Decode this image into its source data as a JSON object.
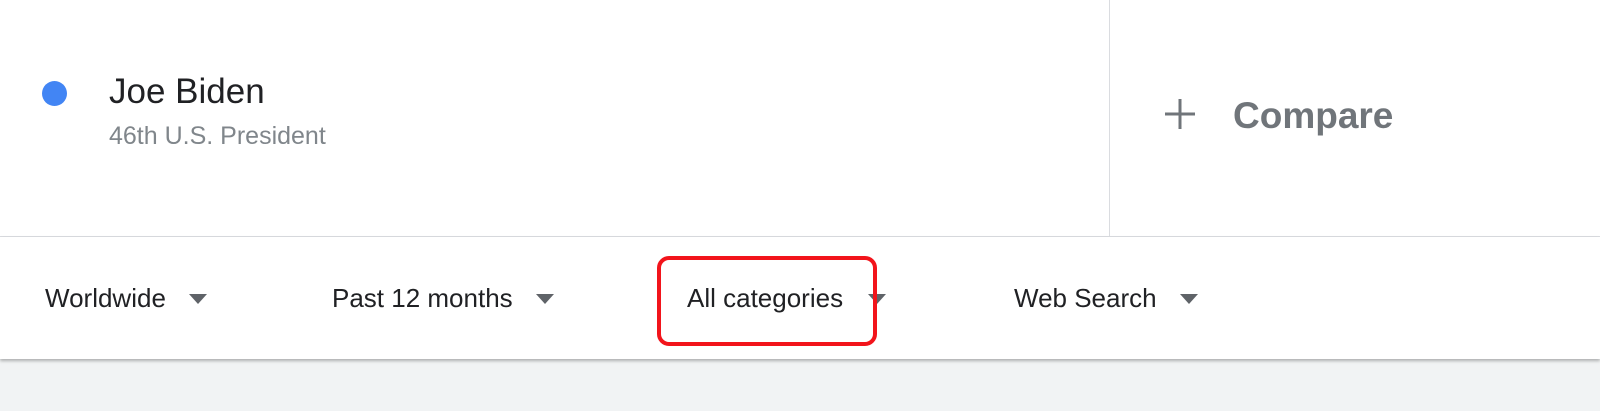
{
  "term": {
    "name": "Joe Biden",
    "description": "46th U.S. President",
    "color": "#4285f4"
  },
  "compare": {
    "label": "Compare",
    "icon": "plus-icon"
  },
  "filters": {
    "location": "Worldwide",
    "time_range": "Past 12 months",
    "category": "All categories",
    "search_property": "Web Search",
    "dropdown_icon": "caret-down-icon"
  },
  "annotation": {
    "highlight_color": "#f2141b",
    "highlighted": "category"
  }
}
